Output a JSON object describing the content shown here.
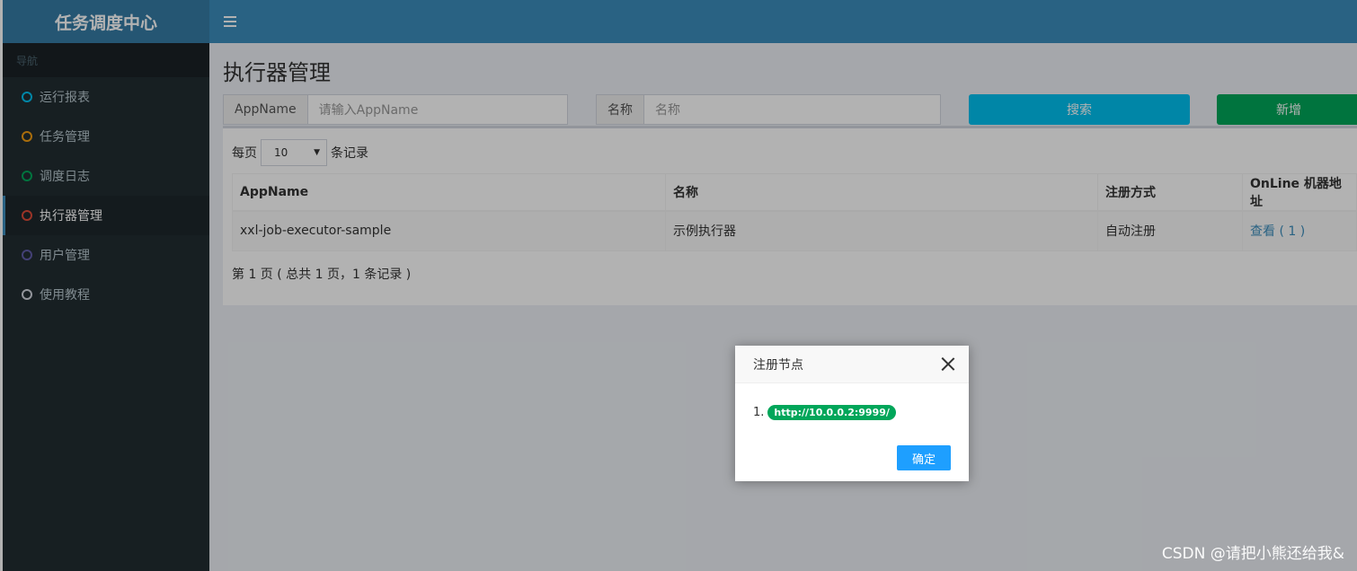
{
  "app": {
    "title": "任务调度中心"
  },
  "sidebar": {
    "header": "导航",
    "items": [
      {
        "label": "运行报表",
        "color": "#00c0ef"
      },
      {
        "label": "任务管理",
        "color": "#f39c12"
      },
      {
        "label": "调度日志",
        "color": "#00a65a"
      },
      {
        "label": "执行器管理",
        "color": "#dd4b39",
        "active": true
      },
      {
        "label": "用户管理",
        "color": "#605ca8"
      },
      {
        "label": "使用教程",
        "color": "#d2d6de"
      }
    ]
  },
  "page": {
    "title": "执行器管理"
  },
  "search": {
    "appname_label": "AppName",
    "appname_placeholder": "请输入AppName",
    "name_label": "名称",
    "name_placeholder": "名称",
    "search_button": "搜索",
    "add_button": "新增"
  },
  "table": {
    "per_page_prefix": "每页",
    "per_page_value": "10",
    "per_page_suffix": "条记录",
    "columns": [
      "AppName",
      "名称",
      "注册方式",
      "OnLine 机器地址"
    ],
    "rows": [
      {
        "appname": "xxl-job-executor-sample",
        "name": "示例执行器",
        "register": "自动注册",
        "online": "查看 ( 1 )"
      }
    ],
    "page_info": "第 1 页 ( 总共 1 页，1 条记录 )"
  },
  "modal": {
    "title": "注册节点",
    "items": [
      {
        "index": "1.",
        "address": "http://10.0.0.2:9999/"
      }
    ],
    "ok_button": "确定"
  },
  "watermark": "CSDN @请把小熊还给我&",
  "colors": {
    "header": "#3c8dbc",
    "logo": "#357ca5",
    "sidebar": "#222d32",
    "search_button": "#00c0ef",
    "add_button": "#00a65a",
    "badge": "#00a65a",
    "ok_button": "#1e9fff"
  }
}
